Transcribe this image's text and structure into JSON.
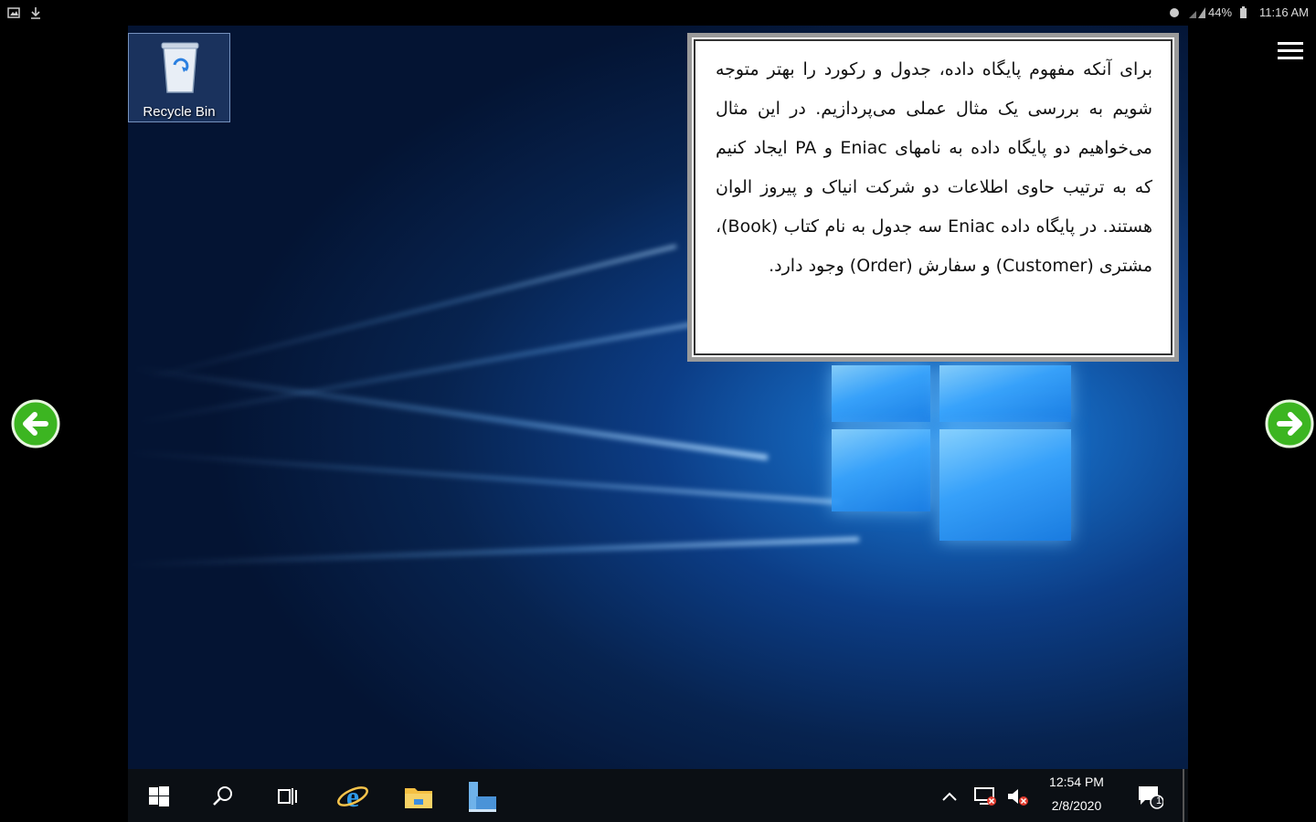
{
  "status_bar": {
    "battery": "44%",
    "time": "11:16 AM"
  },
  "desktop": {
    "recycle_bin_label": "Recycle Bin"
  },
  "note": {
    "paragraph": "برای آنکه مفهوم پایگاه داده، جدول و رکورد را بهتر متوجه شویم به بررسی یک مثال عملی می‌پردازیم. در این مثال می‌خواهیم دو پایگاه داده به نامهای Eniac و PA ایجاد کنیم که به ترتیب حاوی اطلاعات دو شرکت انیاک و پیروز الوان هستند. در پایگاه داده Eniac سه جدول به نام کتاب (Book)، مشتری (Customer) و سفارش (Order) وجود دارد."
  },
  "taskbar": {
    "clock_time": "12:54 PM",
    "clock_date": "2/8/2020",
    "notification_count": "1"
  },
  "colors": {
    "arrow_green": "#3cb521",
    "desktop_blue": "#0c3d86"
  }
}
